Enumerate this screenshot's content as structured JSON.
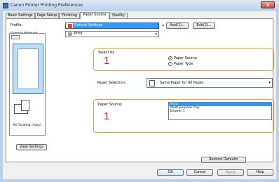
{
  "window": {
    "title": "Canon Printer Printing Preferences",
    "close_label": "x"
  },
  "tabs": [
    {
      "label": "Basic Settings"
    },
    {
      "label": "Page Setup"
    },
    {
      "label": "Finishing"
    },
    {
      "label": "Paper Source"
    },
    {
      "label": "Quality"
    }
  ],
  "active_tab": "Paper Source",
  "profile": {
    "label": "Profile:",
    "value": "Default Settings",
    "add_label": "Add(1)...",
    "edit_label": "Edit(2)..."
  },
  "output_method": {
    "label": "Output Method:",
    "value": "Print"
  },
  "preview": {
    "caption": "A4 [Scaling: Auto]",
    "view_settings_label": "View Settings"
  },
  "select_by": {
    "label": "Select by",
    "options": [
      "Paper Source",
      "Paper Type"
    ],
    "selected": "Paper Source",
    "marker": "1"
  },
  "paper_selection": {
    "label": "Paper Selection:",
    "value": "Same Paper for All Pages"
  },
  "paper_source": {
    "label": "Paper Source:",
    "options": [
      "Auto",
      "Multi-purpose Tray",
      "Drawer 1"
    ],
    "selected": "Auto",
    "marker": "1"
  },
  "restore_defaults_label": "Restore Defaults",
  "footer": {
    "ok_label": "OK",
    "cancel_label": "Cancel",
    "apply_label": "Apply",
    "help_label": "Help"
  },
  "colors": {
    "accent_highlight": "#f1a022",
    "marker_red": "#e31e24",
    "selection_blue": "#3399ff"
  }
}
